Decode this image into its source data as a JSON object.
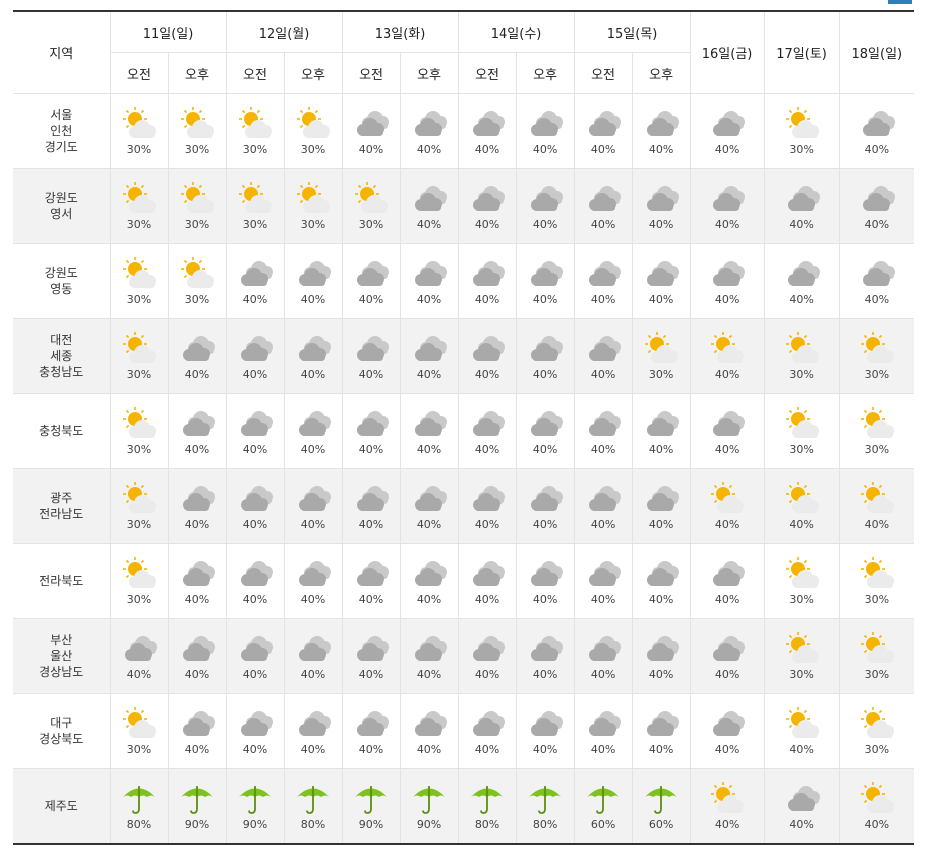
{
  "header": {
    "region_label": "지역",
    "days": [
      {
        "label": "11일(일)",
        "split": true
      },
      {
        "label": "12일(월)",
        "split": true
      },
      {
        "label": "13일(화)",
        "split": true
      },
      {
        "label": "14일(수)",
        "split": true
      },
      {
        "label": "15일(목)",
        "split": true
      },
      {
        "label": "16일(금)",
        "split": false
      },
      {
        "label": "17일(토)",
        "split": false
      },
      {
        "label": "18일(일)",
        "split": false
      }
    ],
    "am_label": "오전",
    "pm_label": "오후"
  },
  "icon_legend": {
    "partly": "partly-cloudy-icon",
    "cloudy": "cloudy-icon",
    "rain": "rain-umbrella-icon"
  },
  "colors": {
    "sun": "#f5b400",
    "cloud": "#a9a9a9",
    "umbrella": "#7dc21e",
    "alt_row_bg": "#f2f2f2",
    "top_border": "#333333"
  },
  "rows": [
    {
      "region": [
        "서울",
        "인천",
        "경기도"
      ],
      "cells": [
        [
          "partly",
          "30%"
        ],
        [
          "partly",
          "30%"
        ],
        [
          "partly",
          "30%"
        ],
        [
          "partly",
          "30%"
        ],
        [
          "cloudy",
          "40%"
        ],
        [
          "cloudy",
          "40%"
        ],
        [
          "cloudy",
          "40%"
        ],
        [
          "cloudy",
          "40%"
        ],
        [
          "cloudy",
          "40%"
        ],
        [
          "cloudy",
          "40%"
        ],
        [
          "cloudy",
          "40%"
        ],
        [
          "partly",
          "30%"
        ],
        [
          "cloudy",
          "40%"
        ]
      ]
    },
    {
      "region": [
        "강원도",
        "영서"
      ],
      "cells": [
        [
          "partly",
          "30%"
        ],
        [
          "partly",
          "30%"
        ],
        [
          "partly",
          "30%"
        ],
        [
          "partly",
          "30%"
        ],
        [
          "partly",
          "30%"
        ],
        [
          "cloudy",
          "40%"
        ],
        [
          "cloudy",
          "40%"
        ],
        [
          "cloudy",
          "40%"
        ],
        [
          "cloudy",
          "40%"
        ],
        [
          "cloudy",
          "40%"
        ],
        [
          "cloudy",
          "40%"
        ],
        [
          "cloudy",
          "40%"
        ],
        [
          "cloudy",
          "40%"
        ]
      ]
    },
    {
      "region": [
        "강원도",
        "영동"
      ],
      "cells": [
        [
          "partly",
          "30%"
        ],
        [
          "partly",
          "30%"
        ],
        [
          "cloudy",
          "40%"
        ],
        [
          "cloudy",
          "40%"
        ],
        [
          "cloudy",
          "40%"
        ],
        [
          "cloudy",
          "40%"
        ],
        [
          "cloudy",
          "40%"
        ],
        [
          "cloudy",
          "40%"
        ],
        [
          "cloudy",
          "40%"
        ],
        [
          "cloudy",
          "40%"
        ],
        [
          "cloudy",
          "40%"
        ],
        [
          "cloudy",
          "40%"
        ],
        [
          "cloudy",
          "40%"
        ]
      ]
    },
    {
      "region": [
        "대전",
        "세종",
        "충청남도"
      ],
      "cells": [
        [
          "partly",
          "30%"
        ],
        [
          "cloudy",
          "40%"
        ],
        [
          "cloudy",
          "40%"
        ],
        [
          "cloudy",
          "40%"
        ],
        [
          "cloudy",
          "40%"
        ],
        [
          "cloudy",
          "40%"
        ],
        [
          "cloudy",
          "40%"
        ],
        [
          "cloudy",
          "40%"
        ],
        [
          "cloudy",
          "40%"
        ],
        [
          "partly",
          "30%"
        ],
        [
          "partly",
          "40%"
        ],
        [
          "partly",
          "30%"
        ],
        [
          "partly",
          "30%"
        ]
      ]
    },
    {
      "region": [
        "충청북도"
      ],
      "cells": [
        [
          "partly",
          "30%"
        ],
        [
          "cloudy",
          "40%"
        ],
        [
          "cloudy",
          "40%"
        ],
        [
          "cloudy",
          "40%"
        ],
        [
          "cloudy",
          "40%"
        ],
        [
          "cloudy",
          "40%"
        ],
        [
          "cloudy",
          "40%"
        ],
        [
          "cloudy",
          "40%"
        ],
        [
          "cloudy",
          "40%"
        ],
        [
          "cloudy",
          "40%"
        ],
        [
          "cloudy",
          "40%"
        ],
        [
          "partly",
          "30%"
        ],
        [
          "partly",
          "30%"
        ]
      ]
    },
    {
      "region": [
        "광주",
        "전라남도"
      ],
      "cells": [
        [
          "partly",
          "30%"
        ],
        [
          "cloudy",
          "40%"
        ],
        [
          "cloudy",
          "40%"
        ],
        [
          "cloudy",
          "40%"
        ],
        [
          "cloudy",
          "40%"
        ],
        [
          "cloudy",
          "40%"
        ],
        [
          "cloudy",
          "40%"
        ],
        [
          "cloudy",
          "40%"
        ],
        [
          "cloudy",
          "40%"
        ],
        [
          "cloudy",
          "40%"
        ],
        [
          "partly",
          "40%"
        ],
        [
          "partly",
          "40%"
        ],
        [
          "partly",
          "40%"
        ]
      ]
    },
    {
      "region": [
        "전라북도"
      ],
      "cells": [
        [
          "partly",
          "30%"
        ],
        [
          "cloudy",
          "40%"
        ],
        [
          "cloudy",
          "40%"
        ],
        [
          "cloudy",
          "40%"
        ],
        [
          "cloudy",
          "40%"
        ],
        [
          "cloudy",
          "40%"
        ],
        [
          "cloudy",
          "40%"
        ],
        [
          "cloudy",
          "40%"
        ],
        [
          "cloudy",
          "40%"
        ],
        [
          "cloudy",
          "40%"
        ],
        [
          "cloudy",
          "40%"
        ],
        [
          "partly",
          "30%"
        ],
        [
          "partly",
          "30%"
        ]
      ]
    },
    {
      "region": [
        "부산",
        "울산",
        "경상남도"
      ],
      "cells": [
        [
          "cloudy",
          "40%"
        ],
        [
          "cloudy",
          "40%"
        ],
        [
          "cloudy",
          "40%"
        ],
        [
          "cloudy",
          "40%"
        ],
        [
          "cloudy",
          "40%"
        ],
        [
          "cloudy",
          "40%"
        ],
        [
          "cloudy",
          "40%"
        ],
        [
          "cloudy",
          "40%"
        ],
        [
          "cloudy",
          "40%"
        ],
        [
          "cloudy",
          "40%"
        ],
        [
          "cloudy",
          "40%"
        ],
        [
          "partly",
          "30%"
        ],
        [
          "partly",
          "30%"
        ]
      ]
    },
    {
      "region": [
        "대구",
        "경상북도"
      ],
      "cells": [
        [
          "partly",
          "30%"
        ],
        [
          "cloudy",
          "40%"
        ],
        [
          "cloudy",
          "40%"
        ],
        [
          "cloudy",
          "40%"
        ],
        [
          "cloudy",
          "40%"
        ],
        [
          "cloudy",
          "40%"
        ],
        [
          "cloudy",
          "40%"
        ],
        [
          "cloudy",
          "40%"
        ],
        [
          "cloudy",
          "40%"
        ],
        [
          "cloudy",
          "40%"
        ],
        [
          "cloudy",
          "40%"
        ],
        [
          "partly",
          "40%"
        ],
        [
          "partly",
          "30%"
        ]
      ]
    },
    {
      "region": [
        "제주도"
      ],
      "cells": [
        [
          "rain",
          "80%"
        ],
        [
          "rain",
          "90%"
        ],
        [
          "rain",
          "90%"
        ],
        [
          "rain",
          "80%"
        ],
        [
          "rain",
          "90%"
        ],
        [
          "rain",
          "90%"
        ],
        [
          "rain",
          "80%"
        ],
        [
          "rain",
          "80%"
        ],
        [
          "rain",
          "60%"
        ],
        [
          "rain",
          "60%"
        ],
        [
          "partly",
          "40%"
        ],
        [
          "cloudy",
          "40%"
        ],
        [
          "partly",
          "40%"
        ]
      ]
    }
  ]
}
